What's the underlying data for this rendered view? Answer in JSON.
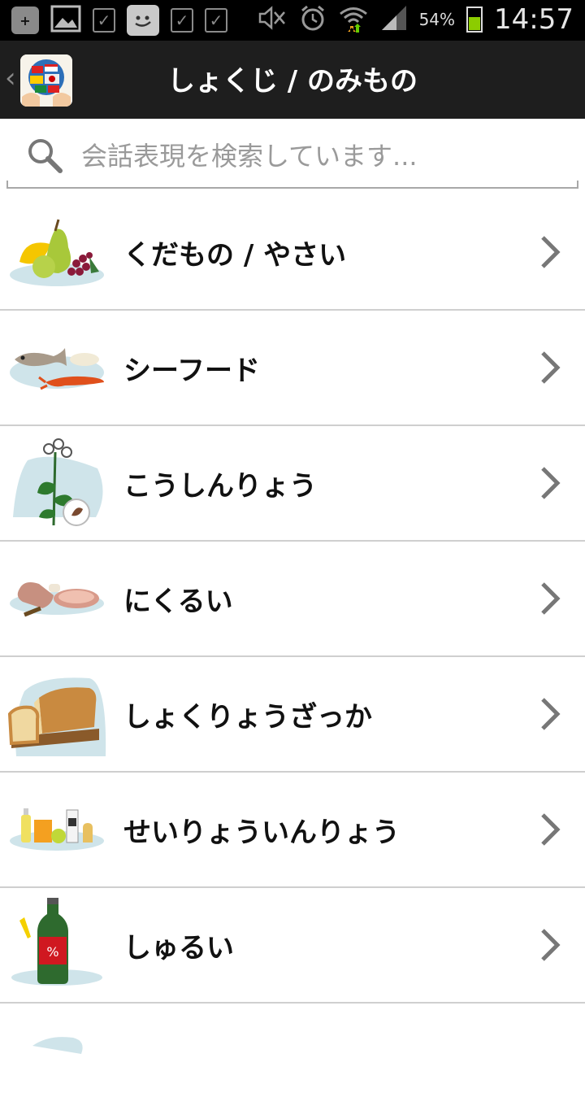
{
  "status_bar": {
    "battery_percent": "54%",
    "battery_level": 0.54,
    "time": "14:57"
  },
  "action_bar": {
    "title": "しょくじ / のみもの"
  },
  "search": {
    "placeholder": "会話表現を検索しています..."
  },
  "categories": [
    {
      "label": "くだもの / やさい",
      "icon": "fruit-vegetables-icon"
    },
    {
      "label": "シーフード",
      "icon": "seafood-icon"
    },
    {
      "label": "こうしんりょう",
      "icon": "spices-icon"
    },
    {
      "label": "にくるい",
      "icon": "meat-icon"
    },
    {
      "label": "しょくりょうざっか",
      "icon": "bread-groceries-icon"
    },
    {
      "label": "せいりょういんりょう",
      "icon": "soft-drinks-icon"
    },
    {
      "label": "しゅるい",
      "icon": "alcohol-bottle-icon"
    }
  ],
  "colors": {
    "action_bar_bg": "#1e1e1e",
    "thumb_backdrop": "#cfe4ea",
    "divider": "#cfcfcf"
  }
}
